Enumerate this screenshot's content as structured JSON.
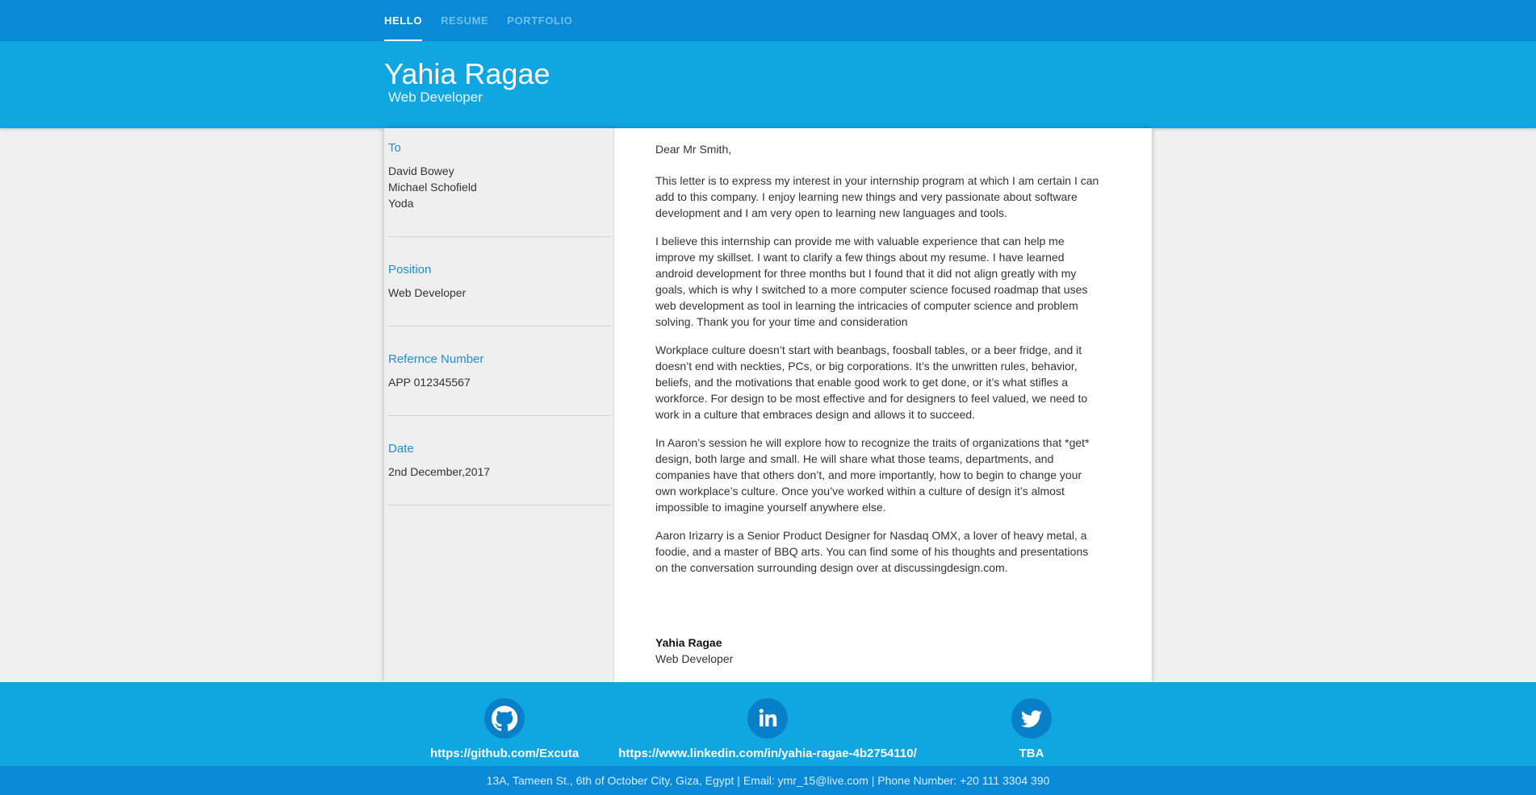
{
  "nav": {
    "items": [
      {
        "label": "HELLO",
        "active": true
      },
      {
        "label": "RESUME",
        "active": false
      },
      {
        "label": "PORTFOLIO",
        "active": false
      }
    ]
  },
  "header": {
    "name": "Yahia Ragae",
    "title": "Web Developer"
  },
  "sidebar": {
    "to_label": "To",
    "recipients": [
      "David Bowey",
      "Michael Schofield",
      "Yoda"
    ],
    "position_label": "Position",
    "position_value": "Web Developer",
    "reference_label": "Refernce Number",
    "reference_value": "APP 012345567",
    "date_label": "Date",
    "date_value": "2nd December,2017"
  },
  "letter": {
    "greeting": "Dear Mr Smith,",
    "paragraphs": [
      "This letter is to express my interest in your internship program at which I am certain I can add to this company. I enjoy learning new things and very passionate about software development and I am very open to learning new languages and tools.",
      "I believe this internship can provide me with valuable experience that can help me improve my skillset. I want to clarify a few things about my resume. I have learned android development for three months but I found that it did not align greatly with my goals, which is why I switched to a more computer science focused roadmap that uses web development as tool in learning the intricacies of computer science and problem solving. Thank you for your time and consideration",
      "Workplace culture doesn’t start with beanbags, foosball tables, or a beer fridge, and it doesn’t end with neckties, PCs, or big corporations. It’s the unwritten rules, behavior, beliefs, and the motivations that enable good work to get done, or it’s what stifles a workforce. For design to be most effective and for designers to feel valued, we need to work in a culture that embraces design and allows it to succeed.",
      "In Aaron’s session he will explore how to recognize the traits of organizations that *get* design, both large and small. He will share what those teams, departments, and companies have that others don’t, and more importantly, how to begin to change your own workplace’s culture. Once you’ve worked within a culture of design it’s almost impossible to imagine yourself anywhere else.",
      "Aaron Irizarry is a Senior Product Designer for Nasdaq OMX, a lover of heavy metal, a foodie, and a master of BBQ arts. You can find some of his thoughts and presentations on the conversation surrounding design over at discussingdesign.com."
    ],
    "signature_name": "Yahia Ragae",
    "signature_title": "Web Developer"
  },
  "footer": {
    "github": {
      "icon": "github-icon",
      "link": "https://github.com/Excuta"
    },
    "linkedin": {
      "icon": "linkedin-icon",
      "link": "https://www.linkedin.com/in/yahia-ragae-4b2754110/"
    },
    "twitter": {
      "icon": "twitter-icon",
      "link": "TBA"
    },
    "contact": "13A, Tameen St., 6th of October City, Giza, Egypt | Email: ymr_15@live.com | Phone Number: +20 111 3304 390"
  },
  "colors": {
    "nav_bg": "#0a89d6",
    "header_bg": "#10a6e2",
    "accent_text": "#1c8fd4",
    "icon_circle": "#0a7fc9"
  }
}
